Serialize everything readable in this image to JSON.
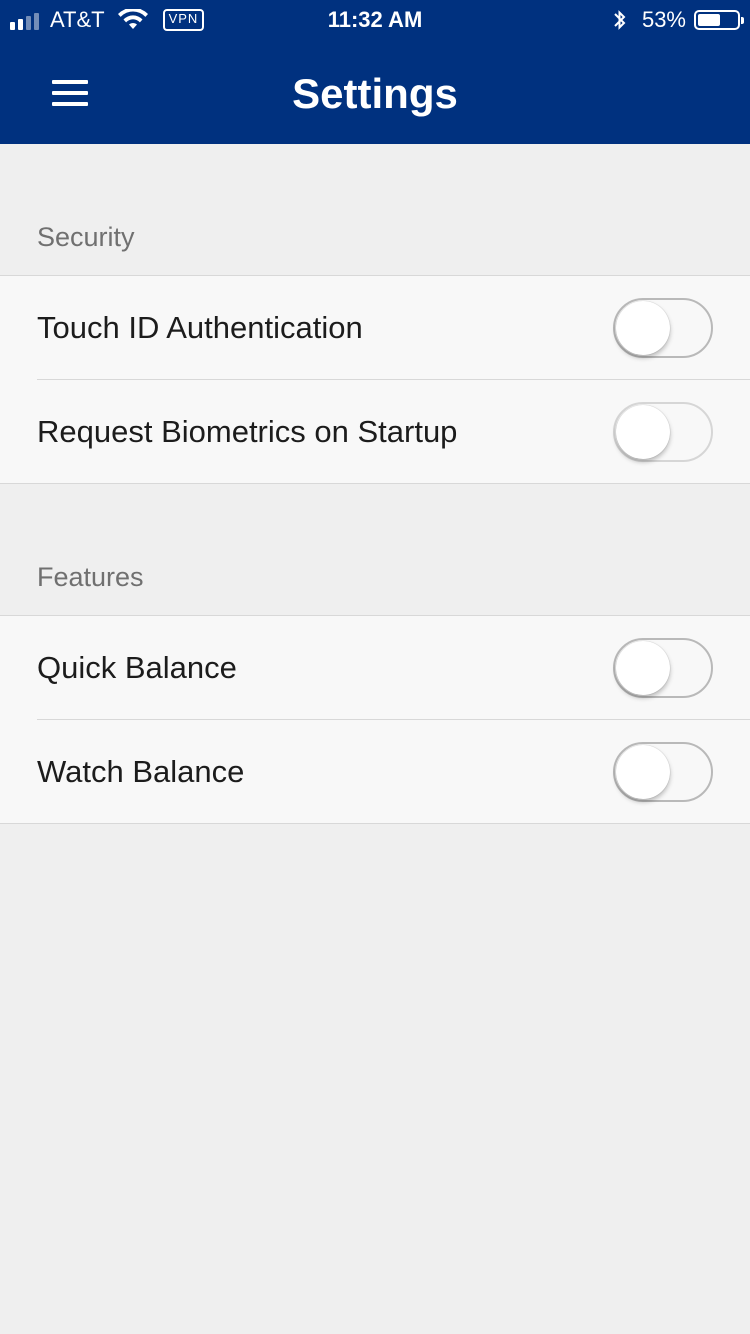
{
  "status_bar": {
    "carrier": "AT&T",
    "vpn": "VPN",
    "time": "11:32 AM",
    "battery": "53%"
  },
  "header": {
    "title": "Settings",
    "menu_icon": "hamburger-menu-icon"
  },
  "colors": {
    "header_bg": "#00317f",
    "page_bg": "#efefef"
  },
  "sections": {
    "security": {
      "title": "Security",
      "items": [
        {
          "label": "Touch ID Authentication",
          "enabled": false
        },
        {
          "label": "Request Biometrics on Startup",
          "enabled": false
        }
      ]
    },
    "features": {
      "title": "Features",
      "items": [
        {
          "label": "Quick Balance",
          "enabled": false
        },
        {
          "label": "Watch Balance",
          "enabled": false
        }
      ]
    }
  }
}
